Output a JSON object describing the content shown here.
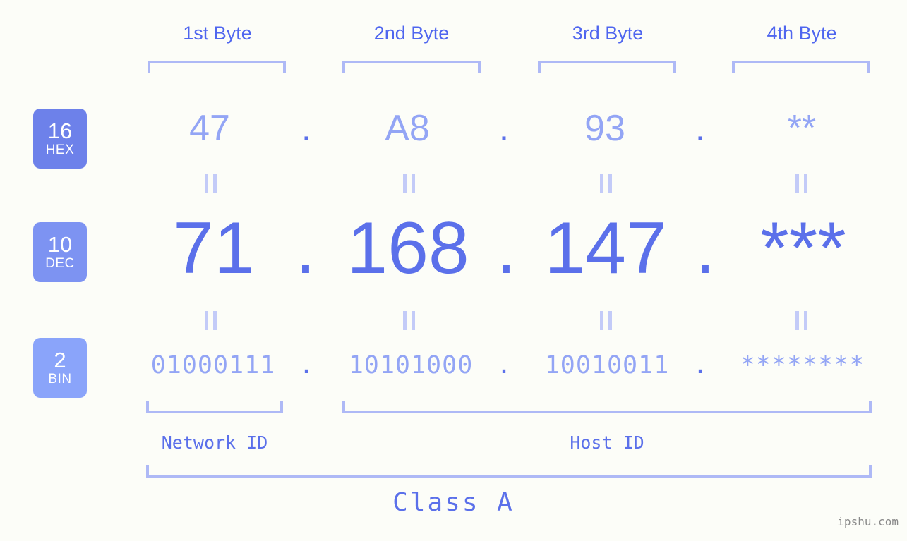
{
  "page": {
    "background_color": "#fcfdf8",
    "watermark": "ipshu.com",
    "class_label": "Class A"
  },
  "colors": {
    "header_text": "#4f66ef",
    "bracket": "#aeb9f6",
    "badge_hex": "#6d81ea",
    "badge_dec": "#7d93f2",
    "badge_bin": "#8aa4fa",
    "value_light": "#93a5f5",
    "value_strong": "#5b70ea",
    "equals_mark": "#c3cbf8",
    "watermark_text": "#8a8a8a"
  },
  "byte_headers": [
    {
      "label": "1st Byte"
    },
    {
      "label": "2nd Byte"
    },
    {
      "label": "3rd Byte"
    },
    {
      "label": "4th Byte"
    }
  ],
  "bases": [
    {
      "number": "16",
      "name": "HEX"
    },
    {
      "number": "10",
      "name": "DEC"
    },
    {
      "number": "2",
      "name": "BIN"
    }
  ],
  "rows": {
    "hex": {
      "values": [
        "47",
        "A8",
        "93",
        "**"
      ],
      "separator": "."
    },
    "dec": {
      "values": [
        "71",
        "168",
        "147",
        "***"
      ],
      "separator": "."
    },
    "bin": {
      "values": [
        "01000111",
        "10101000",
        "10010011",
        "********"
      ],
      "separator": "."
    }
  },
  "equals_marks": {
    "glyph": "||",
    "count_per_row": 4
  },
  "id_sections": [
    {
      "label": "Network ID"
    },
    {
      "label": "Host ID"
    }
  ]
}
